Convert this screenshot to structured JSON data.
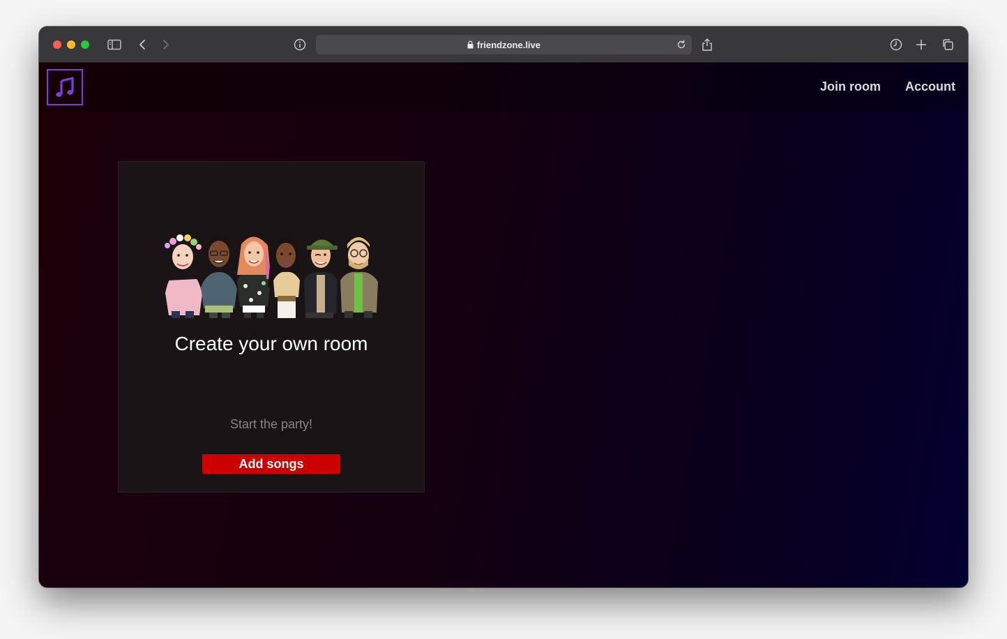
{
  "browser": {
    "url": "friendzone.live"
  },
  "nav": {
    "join_room": "Join room",
    "account": "Account"
  },
  "card": {
    "title": "Create your own room",
    "subtitle": "Start the party!",
    "button_label": "Add songs"
  },
  "colors": {
    "logo_border": "#7b3fd1",
    "button_bg": "#cc0000",
    "card_bg": "#1b1416"
  }
}
